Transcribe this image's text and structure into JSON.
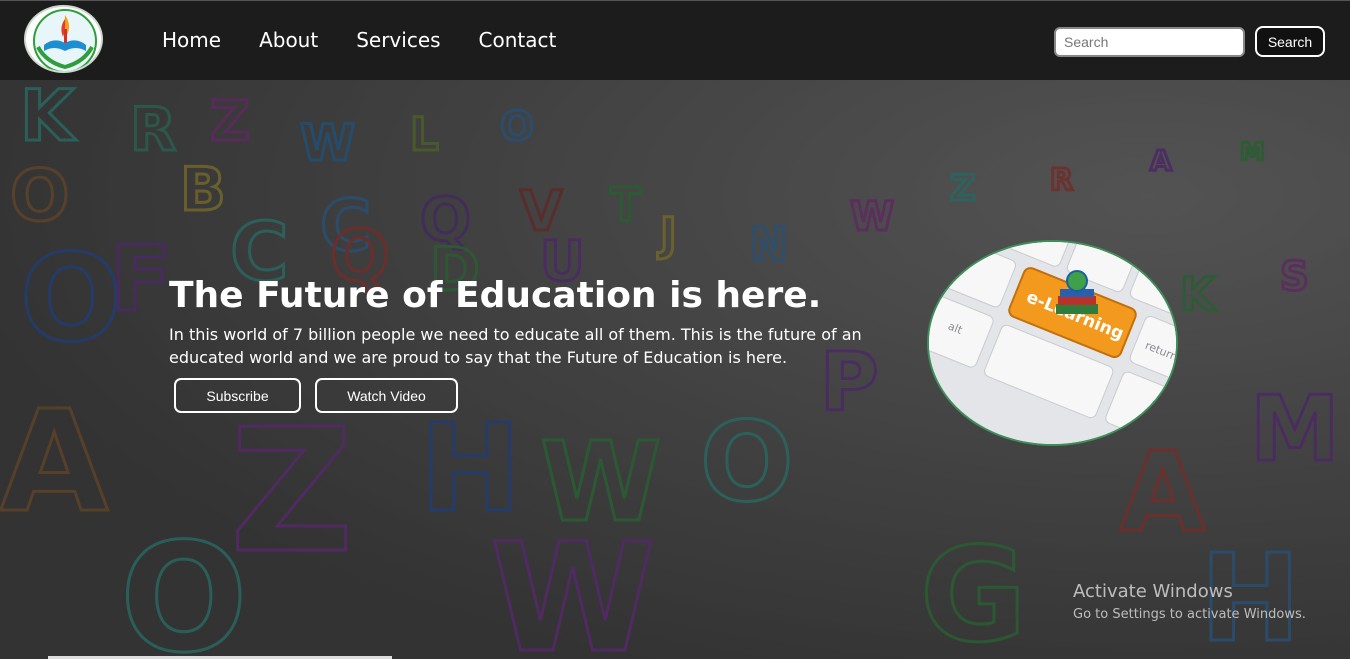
{
  "nav": {
    "links": [
      "Home",
      "About",
      "Services",
      "Contact"
    ],
    "search_placeholder": "Search",
    "search_button": "Search"
  },
  "hero": {
    "title": "The Future of Education is here.",
    "text": "In this world of 7 billion people we need to educate all of them. This is the future of an educated world and we are proud to say that the Future of Education is here.",
    "subscribe_label": "Subscribe",
    "watch_label": "Watch Video",
    "image": {
      "key_label": "e-Learning",
      "key_return": "return",
      "key_alt": "alt"
    }
  },
  "watermark": {
    "title": "Activate Windows",
    "subtitle": "Go to Settings to activate Windows."
  },
  "colors": {
    "navbar": "#1c1c1c",
    "hero_overlay": "#3f3f3f",
    "accent_key": "#f39a1e",
    "logo_ring": "#2f9d3a"
  }
}
